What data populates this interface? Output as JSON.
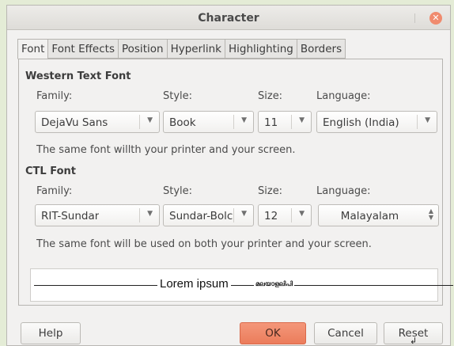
{
  "window": {
    "title": "Character",
    "close_icon": "close-icon"
  },
  "tabs": [
    {
      "label": "Font",
      "active": true
    },
    {
      "label": "Font Effects",
      "active": false
    },
    {
      "label": "Position",
      "active": false
    },
    {
      "label": "Hyperlink",
      "active": false
    },
    {
      "label": "Highlighting",
      "active": false
    },
    {
      "label": "Borders",
      "active": false
    }
  ],
  "western": {
    "heading": "Western Text Font",
    "family_label": "Family:",
    "style_label": "Style:",
    "size_label": "Size:",
    "language_label": "Language:",
    "family": "DejaVu Sans",
    "style": "Book",
    "size": "11",
    "language": "English (India)",
    "note": "The same font willth your printer and your screen."
  },
  "ctl": {
    "heading": "CTL Font",
    "family_label": "Family:",
    "style_label": "Style:",
    "size_label": "Size:",
    "language_label": "Language:",
    "family": "RIT-Sundar",
    "style": "Sundar-Bolc",
    "size": "12",
    "language": "Malayalam",
    "note": "The same font will be used on both your printer and your screen."
  },
  "preview": {
    "text": "Lorem ipsum",
    "ctl_text": "മലയാളലിപി"
  },
  "buttons": {
    "help": "Help",
    "ok": "OK",
    "cancel": "Cancel",
    "reset": "Reset"
  },
  "colors": {
    "ok_accent": "#eb7c5b",
    "close": "#f08b6e",
    "desktop": "#e4ecd6"
  }
}
